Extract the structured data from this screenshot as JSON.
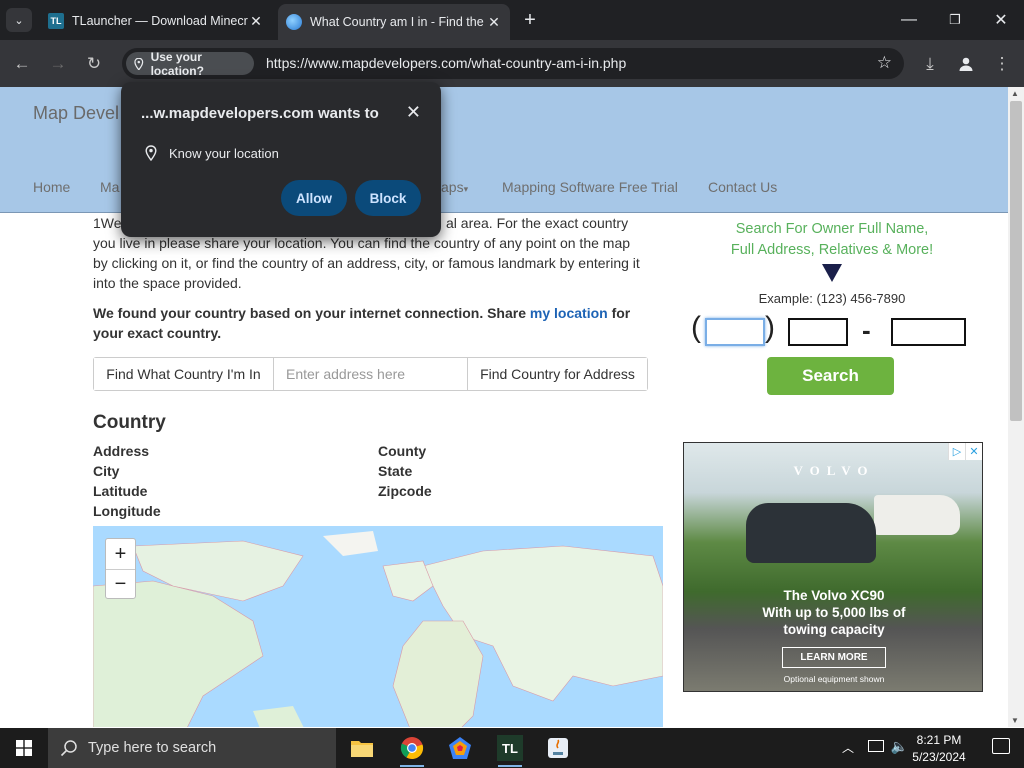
{
  "browser": {
    "tabs": [
      {
        "title": "TLauncher — Download Minecraft",
        "favicon": "tlauncher-icon",
        "favicon_text": "TL"
      },
      {
        "title": "What Country am I in - Find the",
        "favicon": "globe-icon"
      }
    ],
    "location_chip": "Use your location?",
    "url": "https://www.mapdevelopers.com/what-country-am-i-in.php"
  },
  "permission_popup": {
    "title": "...w.mapdevelopers.com wants to",
    "permission": "Know your location",
    "allow_label": "Allow",
    "block_label": "Block"
  },
  "site": {
    "brand": "Map Devel",
    "nav": [
      "Home",
      "Ma",
      "aps",
      "Mapping Software Free Trial",
      "Contact Us"
    ]
  },
  "main": {
    "intro_lines": [
      "1We",
      "al area. For the exact country",
      "you live in please share your location. You can find the country of any point on the map",
      "by clicking on it, or find the country of an address, city, or famous landmark by entering it",
      "into the space provided."
    ],
    "found_text": "We found your country based on your internet connection. Share ",
    "found_link": "my location",
    "found_suffix": " for",
    "found_line2": "your exact country.",
    "find_button": "Find What Country I'm In",
    "address_placeholder": "Enter address here",
    "find_address_button": "Find Country for Address",
    "country_heading": "Country",
    "fields_left": [
      "Address",
      "City",
      "Latitude",
      "Longitude"
    ],
    "fields_right": [
      "County",
      "State",
      "Zipcode"
    ],
    "zoom_in": "+",
    "zoom_out": "−"
  },
  "sidebar": {
    "promo_line1": "Search For Owner Full Name,",
    "promo_line2": "Full Address, Relatives & More!",
    "example": "Example: (123) 456-7890",
    "open_paren": "(",
    "close_paren": ")",
    "dash": "-",
    "search_label": "Search"
  },
  "ad": {
    "brand": "VOLVO",
    "headline_line1": "The Volvo XC90",
    "headline_line2": "With up to 5,000 lbs of",
    "headline_line3": "towing capacity",
    "cta": "LEARN MORE",
    "note": "Optional equipment shown"
  },
  "taskbar": {
    "search_placeholder": "Type here to search",
    "apps": [
      "file-explorer-icon",
      "chrome-icon",
      "app-icon",
      "tlauncher-icon",
      "java-icon"
    ],
    "time": "8:21 PM",
    "date": "5/23/2024"
  },
  "colors": {
    "header_bg": "#a7c7e7",
    "promo_green": "#58b15c",
    "search_button": "#6db33f",
    "link_blue": "#1d63b5",
    "popup_button": "#0b4a7a"
  }
}
